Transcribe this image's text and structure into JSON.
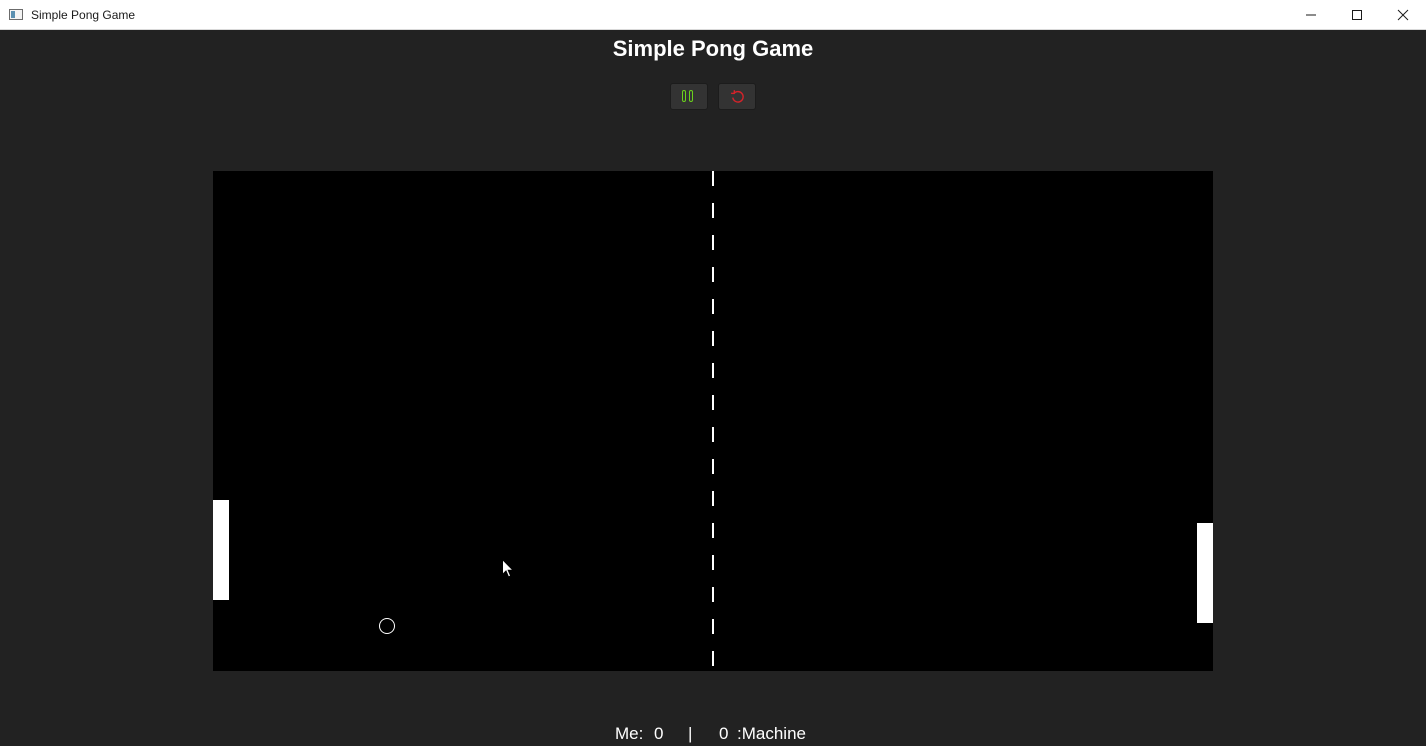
{
  "window": {
    "title": "Simple Pong Game",
    "icon": "app-icon",
    "controls": [
      "minimize-icon",
      "maximize-icon",
      "close-icon"
    ]
  },
  "header": {
    "title": "Simple Pong Game"
  },
  "controls": {
    "pause": {
      "icon": "pause-icon",
      "color": "#6ad11c"
    },
    "reset": {
      "icon": "reset-icon",
      "color": "#d4232a"
    }
  },
  "court": {
    "background": "#000000",
    "net_dashes": 16
  },
  "score": {
    "me_label": "Me:",
    "me": "0",
    "separator": "|",
    "machine": "0",
    "machine_label": ":Machine"
  },
  "colors": {
    "background": "#222222",
    "court": "#000000",
    "foreground": "#ffffff",
    "pause_accent": "#6ad11c",
    "reset_accent": "#d4232a"
  }
}
